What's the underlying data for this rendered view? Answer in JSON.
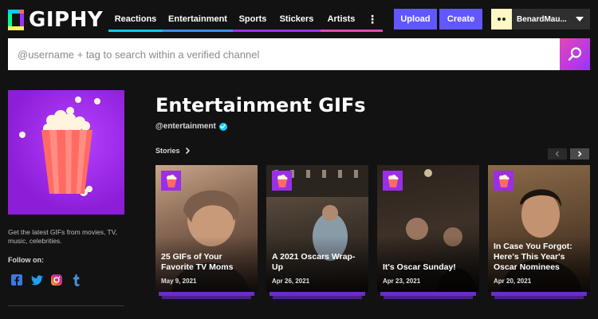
{
  "header": {
    "logo_text": "GIPHY",
    "nav": [
      {
        "label": "Reactions",
        "color": "#00ccff"
      },
      {
        "label": "Entertainment",
        "color": "#3e8bff"
      },
      {
        "label": "Sports",
        "color": "#9933ff"
      },
      {
        "label": "Stickers",
        "color": "#9933ff"
      },
      {
        "label": "Artists",
        "color": "#e646b6"
      },
      {
        "label": "⋮",
        "color": "#e646b6"
      }
    ],
    "upload_label": "Upload",
    "create_label": "Create",
    "user_name": "BenardMau..."
  },
  "search": {
    "placeholder": "@username + tag to search within a verified channel"
  },
  "channel": {
    "description": "Get the latest GIFs from movies, TV, music, celebrities.",
    "follow_label": "Follow on:",
    "title": "Entertainment GIFs",
    "handle": "@entertainment"
  },
  "stories": {
    "label": "Stories",
    "cards": [
      {
        "title": "25 GIFs of Your Favorite TV Moms",
        "date": "May 9, 2021"
      },
      {
        "title": "A 2021 Oscars Wrap-Up",
        "date": "Apr 26, 2021"
      },
      {
        "title": "It's Oscar Sunday!",
        "date": "Apr 23, 2021"
      },
      {
        "title": "In Case You Forgot: Here's This Year's Oscar Nominees",
        "date": "Apr 20, 2021"
      }
    ]
  },
  "colors": {
    "accent": "#6157ff",
    "verified": "#15cdff",
    "badge": "#9b2ee8"
  }
}
